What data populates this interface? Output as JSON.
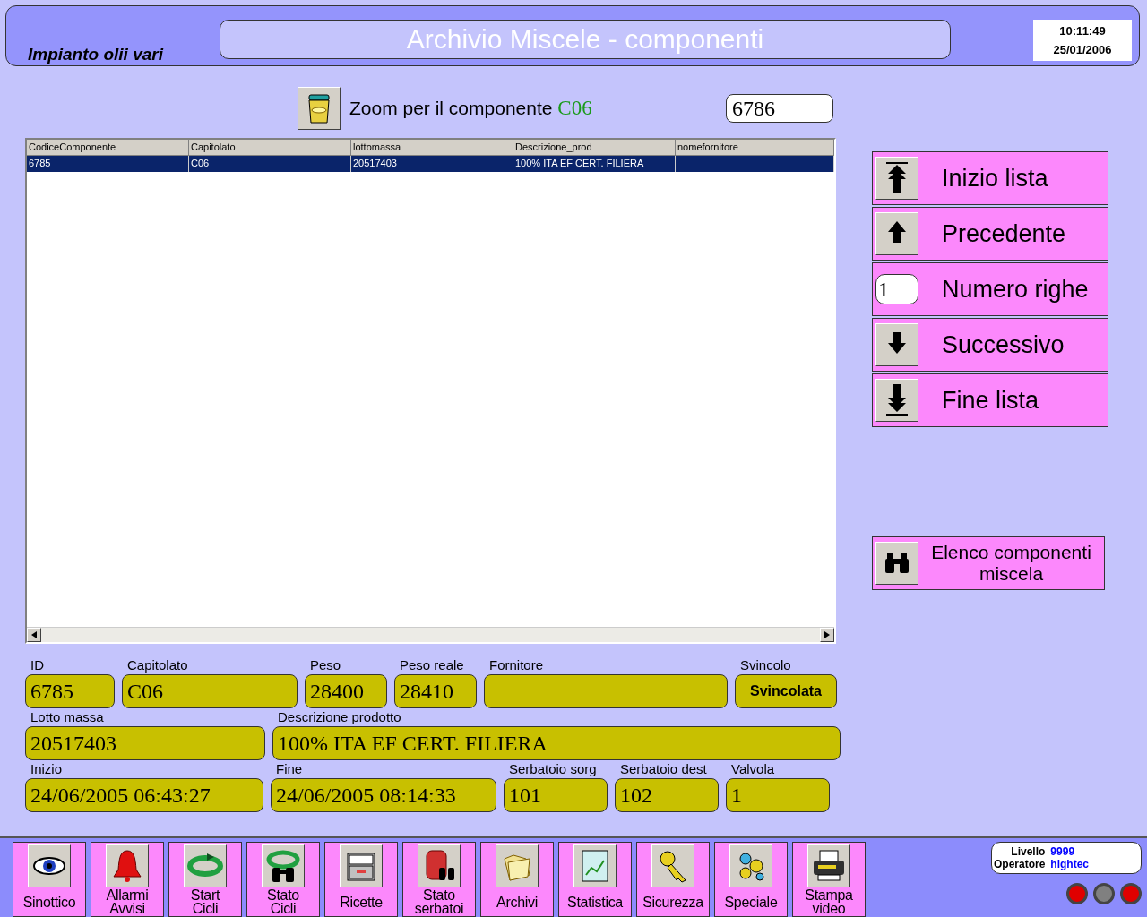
{
  "header": {
    "plant": "Impianto olii vari",
    "title": "Archivio Miscele - componenti",
    "time": "10:11:49",
    "date": "25/01/2006"
  },
  "zoom": {
    "label": "Zoom per il componente",
    "code": "C06",
    "value": "6786"
  },
  "table": {
    "columns": [
      "CodiceComponente",
      "Capitolato",
      "lottomassa",
      "Descrizione_prod",
      "nomefornitore"
    ],
    "rows": [
      {
        "cells": [
          "6785",
          "C06",
          "20517403",
          "100% ITA EF CERT. FILIERA",
          null
        ],
        "selected": true
      }
    ]
  },
  "nav": [
    {
      "kind": "first",
      "label": "Inizio lista"
    },
    {
      "kind": "prev",
      "label": "Precedente"
    },
    {
      "kind": "count",
      "label": "Numero righe",
      "value": "1"
    },
    {
      "kind": "next",
      "label": "Successivo"
    },
    {
      "kind": "last",
      "label": "Fine lista"
    }
  ],
  "list_button": {
    "label": "Elenco componenti miscela"
  },
  "form": [
    [
      {
        "label": "ID",
        "value": "6785",
        "kind": "text"
      },
      {
        "label": "Capitolato",
        "value": "C06",
        "kind": "text"
      },
      {
        "label": "Peso",
        "value": "28400",
        "kind": "text"
      },
      {
        "label": "Peso reale",
        "value": "28410",
        "kind": "text"
      },
      {
        "label": "Fornitore",
        "kind": "text"
      },
      {
        "label": "Svincolo",
        "value": "Svincolata",
        "kind": "button"
      }
    ],
    [
      {
        "label": "Lotto massa",
        "value": "20517403",
        "kind": "text"
      },
      {
        "label": "Descrizione prodotto",
        "value": "100% ITA EF CERT. FILIERA",
        "kind": "text"
      }
    ],
    [
      {
        "label": "Inizio",
        "value": "24/06/2005 06:43:27",
        "kind": "text"
      },
      {
        "label": "Fine",
        "value": "24/06/2005 08:14:33",
        "kind": "text"
      },
      {
        "label": "Serbatoio sorg",
        "value": "101",
        "kind": "text"
      },
      {
        "label": "Serbatoio dest",
        "value": "102",
        "kind": "text"
      },
      {
        "label": "Valvola",
        "value": "1",
        "kind": "text"
      }
    ]
  ],
  "toolbar": [
    {
      "kind": "eye",
      "label": "Sinottico"
    },
    {
      "kind": "bell",
      "label": "Allarmi\nAvvisi"
    },
    {
      "kind": "cycle",
      "label": "Start\nCicli"
    },
    {
      "kind": "cyclebin",
      "label": "Stato\nCicli"
    },
    {
      "kind": "cabinet",
      "label": "Ricette"
    },
    {
      "kind": "tank",
      "label": "Stato\nserbatoi"
    },
    {
      "kind": "folder",
      "label": "Archivi"
    },
    {
      "kind": "chart",
      "label": "Statistica"
    },
    {
      "kind": "key",
      "label": "Sicurezza"
    },
    {
      "kind": "gears",
      "label": "Speciale"
    },
    {
      "kind": "printer",
      "label": "Stampa\nvideo"
    }
  ],
  "status": {
    "level_label": "Livello",
    "level": "9999",
    "operator_label": "Operatore",
    "operator": "hightec"
  },
  "lamps": [
    {
      "color": "#e00000"
    },
    {
      "color": "#808080"
    },
    {
      "color": "#e00000"
    }
  ]
}
